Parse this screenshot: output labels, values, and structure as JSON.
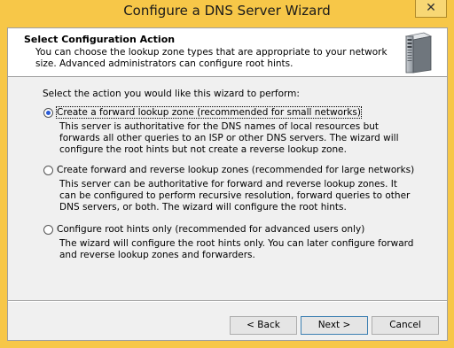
{
  "window": {
    "title": "Configure a DNS Server Wizard",
    "close_glyph": "✕"
  },
  "header": {
    "title": "Select Configuration Action",
    "description": "You can choose the lookup zone types that are appropriate to your network size. Advanced administrators can configure root hints.",
    "icon": "server-icon"
  },
  "prompt": "Select the action you would like this wizard to perform:",
  "options": [
    {
      "label": "Create a forward lookup zone (recommended for small networks)",
      "description": "This server is authoritative for the DNS names of local resources but forwards all other queries to an ISP or other DNS servers. The wizard will configure the root hints but not create a reverse lookup zone.",
      "selected": true
    },
    {
      "label": "Create forward and reverse lookup zones (recommended for large networks)",
      "description": "This server can be authoritative for forward and reverse lookup zones. It can be configured to perform recursive resolution, forward queries to other DNS servers, or both. The wizard will configure the root hints.",
      "selected": false
    },
    {
      "label": "Configure root hints only (recommended for advanced users only)",
      "description": "The wizard will configure the root hints only. You can later configure forward and reverse lookup zones and forwarders.",
      "selected": false
    }
  ],
  "buttons": {
    "back": "< Back",
    "next": "Next >",
    "cancel": "Cancel"
  },
  "colors": {
    "title_bar": "#f7c748",
    "radio_selected": "#2a5bd7"
  }
}
